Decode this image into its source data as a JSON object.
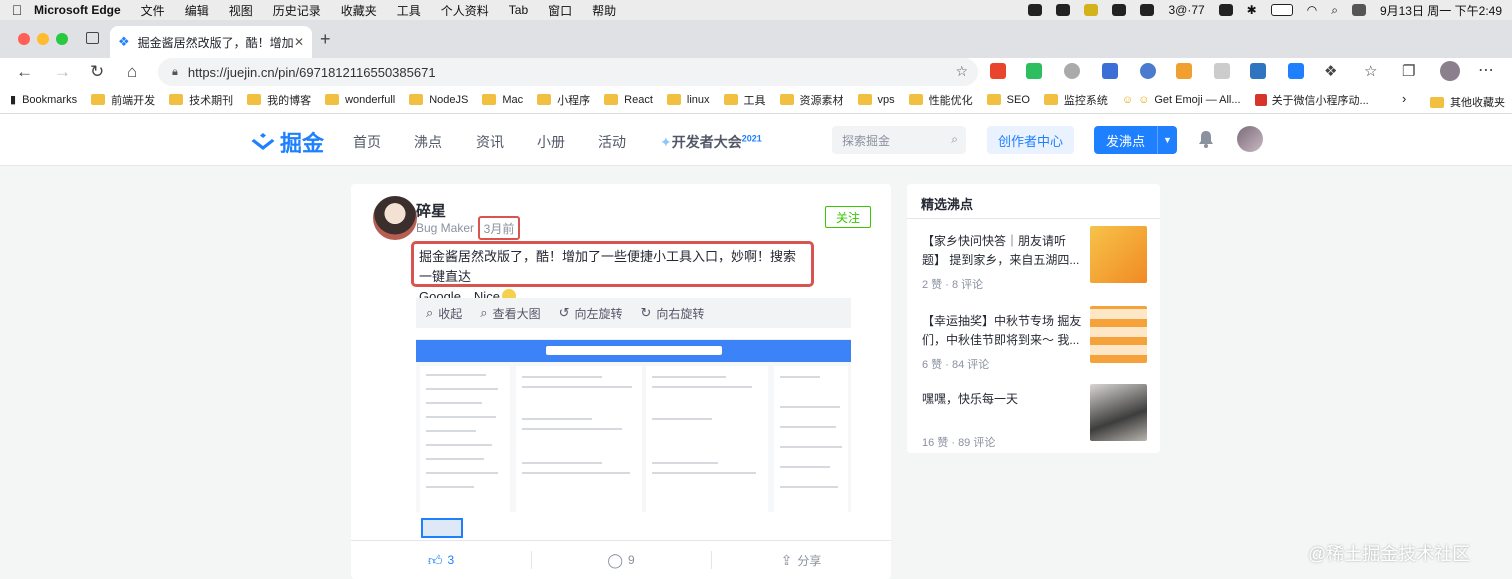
{
  "menubar": {
    "app": "Microsoft Edge",
    "items": [
      "文件",
      "编辑",
      "视图",
      "历史记录",
      "收藏夹",
      "工具",
      "个人资料",
      "Tab",
      "窗口",
      "帮助"
    ],
    "network_speed": "3@·77",
    "datetime": "9月13日 周一 下午2:49"
  },
  "browser": {
    "tab_title": "掘金酱居然改版了，酷！增加了一",
    "url": "https://juejin.cn/pin/6971812116550385671",
    "bookmarks": [
      "Bookmarks",
      "前端开发",
      "技术期刊",
      "我的博客",
      "wonderfull",
      "NodeJS",
      "Mac",
      "小程序",
      "React",
      "linux",
      "工具",
      "资源素材",
      "vps",
      "性能优化",
      "SEO",
      "监控系统",
      "Get Emoji — All...",
      "关于微信小程序动...",
      "其他收藏夹"
    ]
  },
  "site": {
    "logo_text": "掘金",
    "nav": [
      "首页",
      "沸点",
      "资讯",
      "小册",
      "活动"
    ],
    "devcon_label": "开发者大会",
    "devcon_year": "2021",
    "search_placeholder": "探索掘金",
    "creator_center": "创作者中心",
    "post_button": "发沸点"
  },
  "pin": {
    "author": "碎星",
    "job": "Bug Maker",
    "time": "3月前",
    "follow": "关注",
    "content_line1": "掘金酱居然改版了，酷！增加了一些便捷小工具入口，妙啊！搜索一键直达",
    "content_line2": "Google，Nice",
    "viewer_tools": [
      "收起",
      "查看大图",
      "向左旋转",
      "向右旋转"
    ],
    "like_count": "3",
    "comment_count": "9",
    "share_label": "分享"
  },
  "panel": {
    "title": "精选沸点",
    "items": [
      {
        "text": "【家乡快问快答｜朋友请听题】 提到家乡，来自五湖四...",
        "stats": "2 赞 · 8 评论",
        "thumb_color": "#f5a623"
      },
      {
        "text": "【幸运抽奖】中秋节专场 掘友们，中秋佳节即将到来～ 我...",
        "stats": "6 赞 · 84 评论",
        "thumb_color": "#f08a24"
      },
      {
        "text": "嘿嘿，快乐每一天",
        "stats": "16 赞 · 89 评论",
        "thumb_color": "#6b6b6b"
      }
    ]
  },
  "watermark": "@稀土掘金技术社区",
  "colors": {
    "accent": "#1e80ff",
    "highlight_border": "#d9534f",
    "follow_green": "#37c700"
  }
}
